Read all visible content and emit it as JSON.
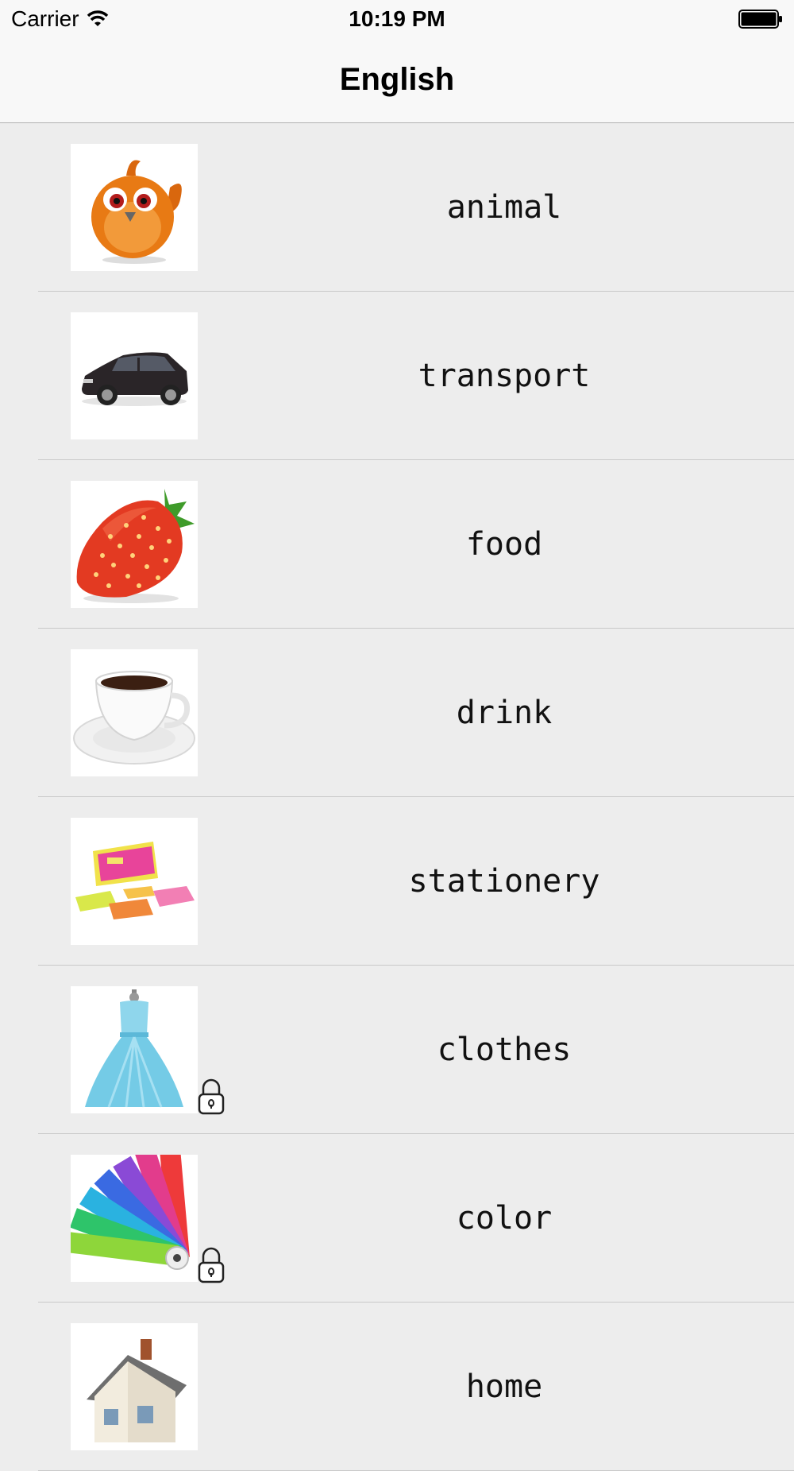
{
  "status_bar": {
    "carrier": "Carrier",
    "time": "10:19 PM",
    "wifi_icon": "wifi-icon",
    "battery_icon": "battery-icon"
  },
  "nav": {
    "title": "English"
  },
  "categories": [
    {
      "label": "animal",
      "icon": "bird-icon",
      "locked": false
    },
    {
      "label": "transport",
      "icon": "car-icon",
      "locked": false
    },
    {
      "label": "food",
      "icon": "strawberry-icon",
      "locked": false
    },
    {
      "label": "drink",
      "icon": "coffee-cup-icon",
      "locked": false
    },
    {
      "label": "stationery",
      "icon": "sticky-notes-icon",
      "locked": false
    },
    {
      "label": "clothes",
      "icon": "dress-icon",
      "locked": true
    },
    {
      "label": "color",
      "icon": "color-swatch-icon",
      "locked": true
    },
    {
      "label": "home",
      "icon": "house-icon",
      "locked": false
    }
  ]
}
